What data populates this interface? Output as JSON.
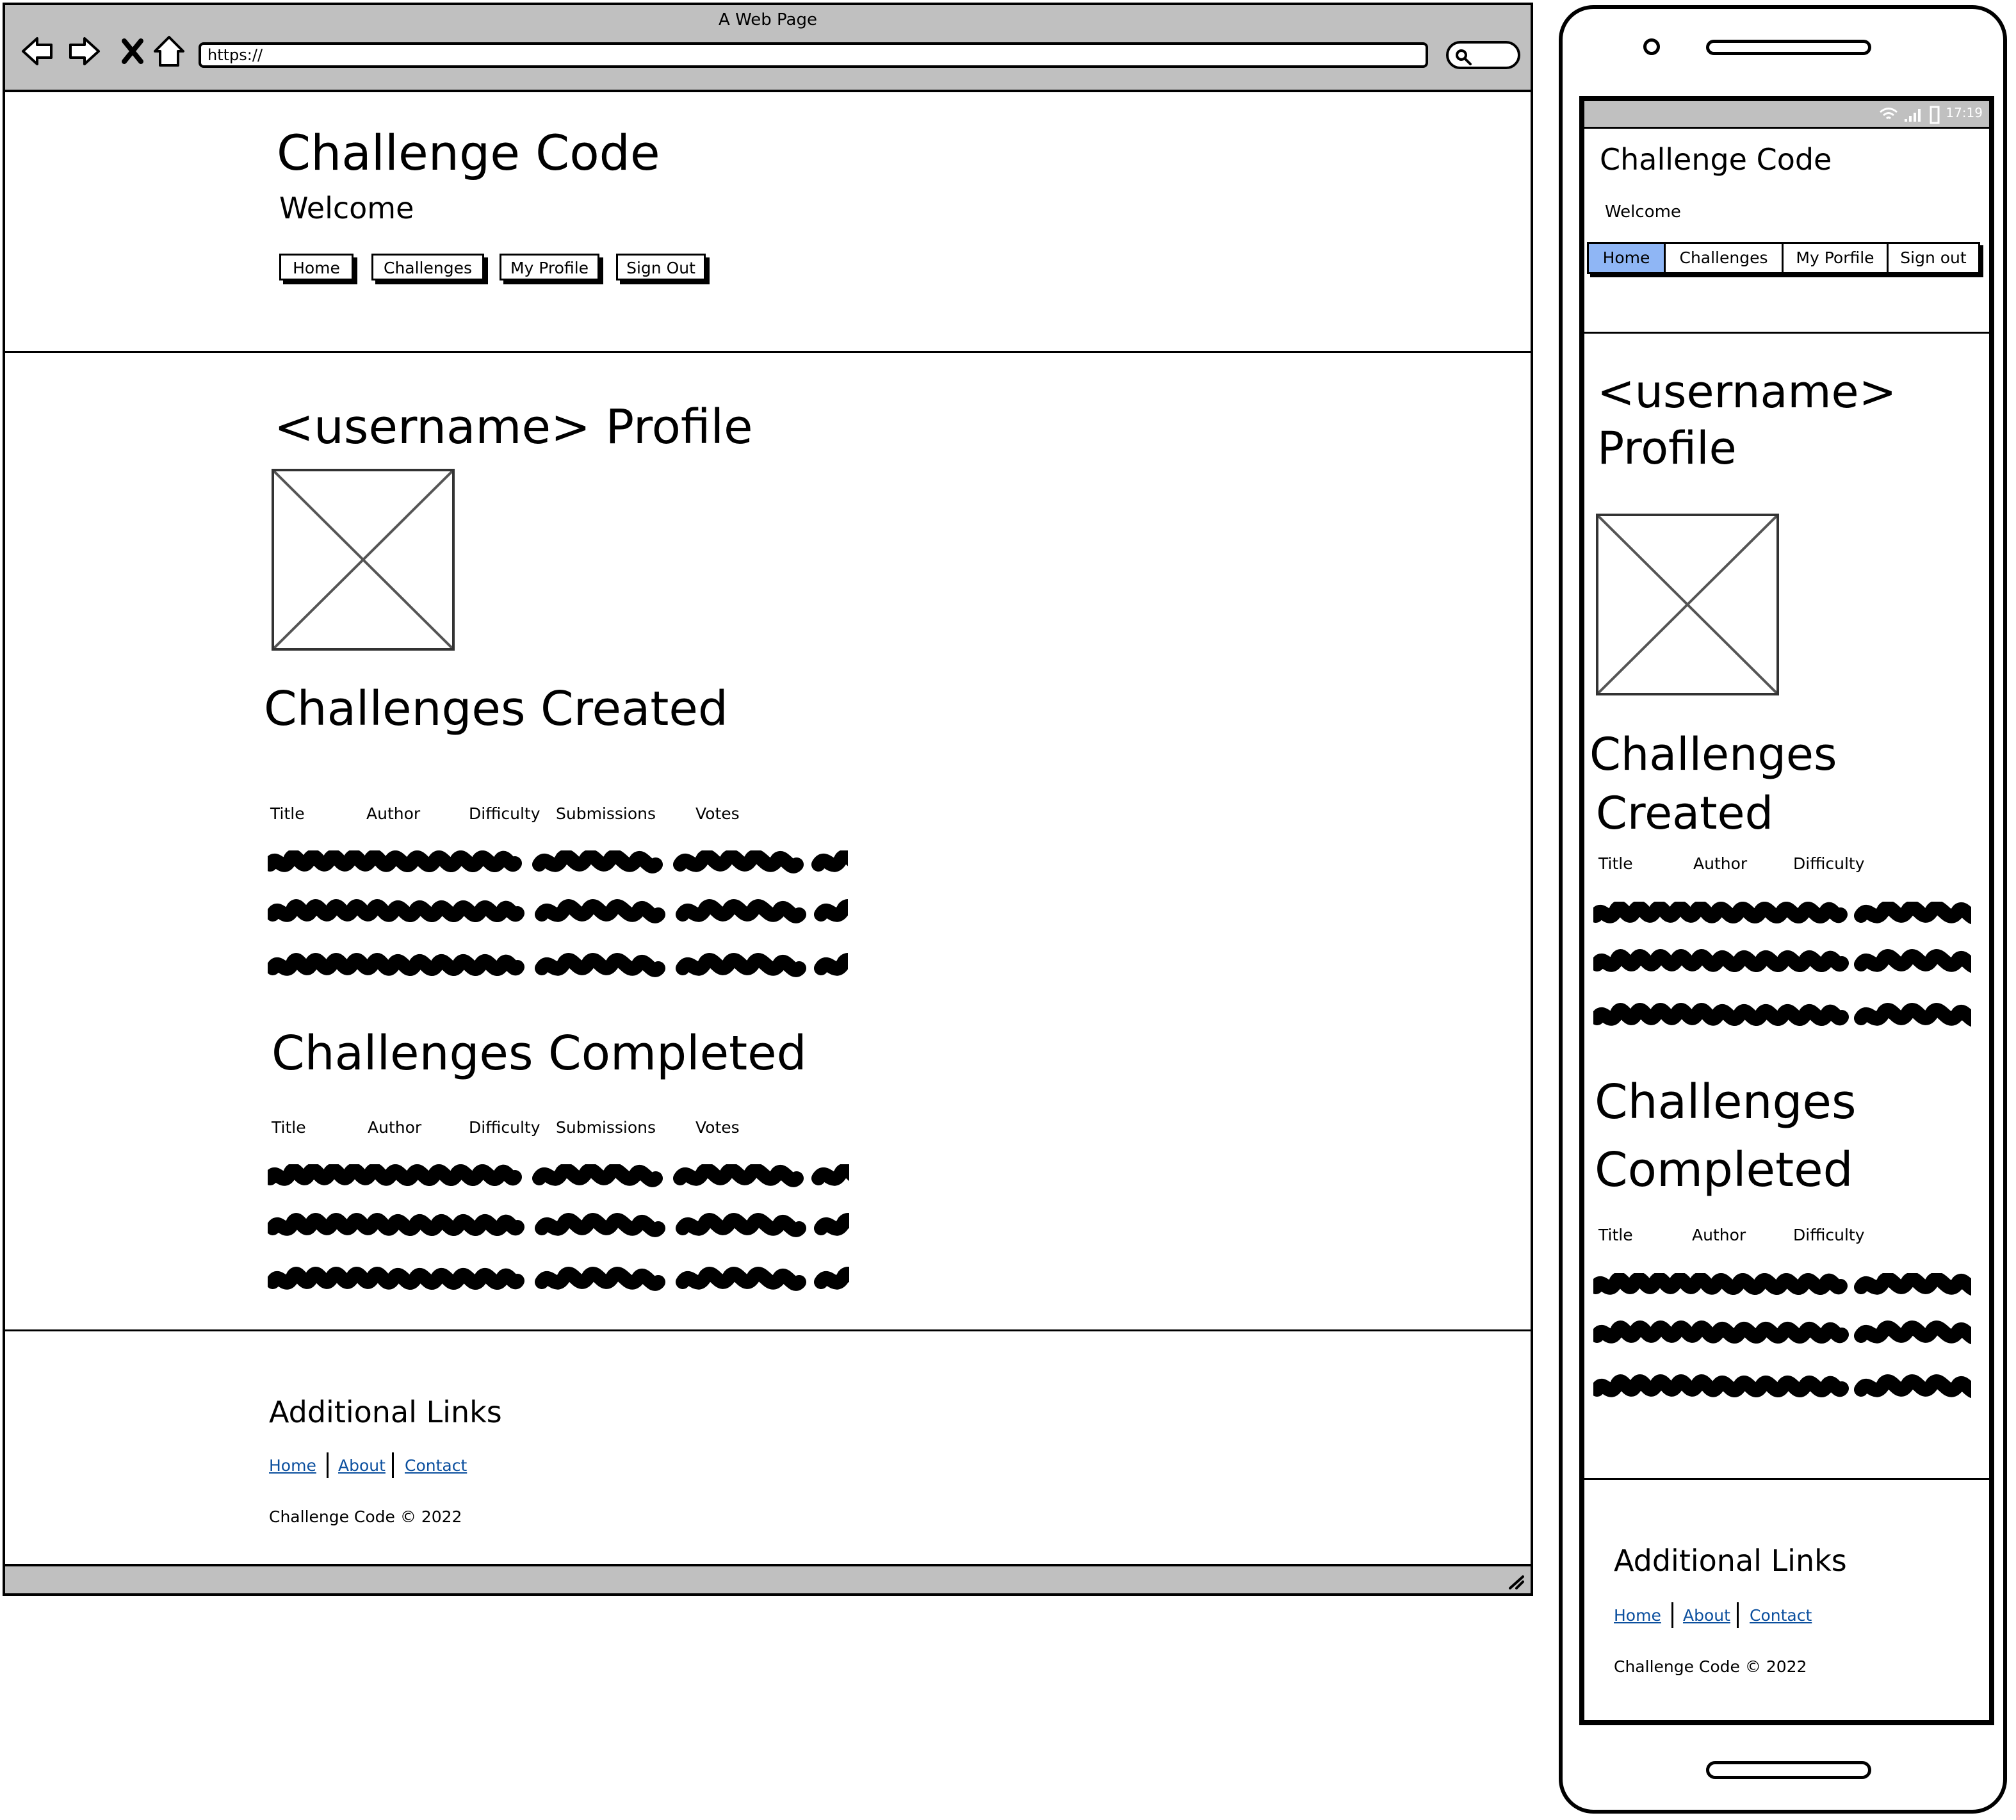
{
  "browser": {
    "window_title": "A Web Page",
    "url": "https://"
  },
  "site": {
    "title": "Challenge Code",
    "welcome": "Welcome",
    "nav": [
      "Home",
      "Challenges",
      "My Profile",
      "Sign Out"
    ]
  },
  "profile": {
    "heading": "<username> Profile",
    "created_heading": "Challenges Created",
    "completed_heading": "Challenges Completed",
    "columns": [
      "Title",
      "Author",
      "Difficulty",
      "Submissions",
      "Votes"
    ]
  },
  "footer": {
    "heading": "Additional Links",
    "links": [
      "Home",
      "About",
      "Contact"
    ],
    "copyright": "Challenge Code © 2022"
  },
  "mobile": {
    "status_time": "17:19",
    "title": "Challenge Code",
    "welcome": "Welcome",
    "tabs": [
      "Home",
      "Challenges",
      "My Porfile",
      "Sign out"
    ],
    "active_tab": "Home",
    "profile_heading_line1": "<username>",
    "profile_heading_line2": "Profile",
    "created_line1": "Challenges",
    "created_line2": "Created",
    "completed_line1": "Challenges",
    "completed_line2": "Completed",
    "columns": [
      "Title",
      "Author",
      "Difficulty"
    ],
    "footer_heading": "Additional Links",
    "footer_links": [
      "Home",
      "About",
      "Contact"
    ],
    "copyright": "Challenge Code © 2022"
  },
  "colors": {
    "active_tab": "#8fb6f5",
    "link": "#0b4f9e",
    "chrome": "#c0c0c0"
  }
}
